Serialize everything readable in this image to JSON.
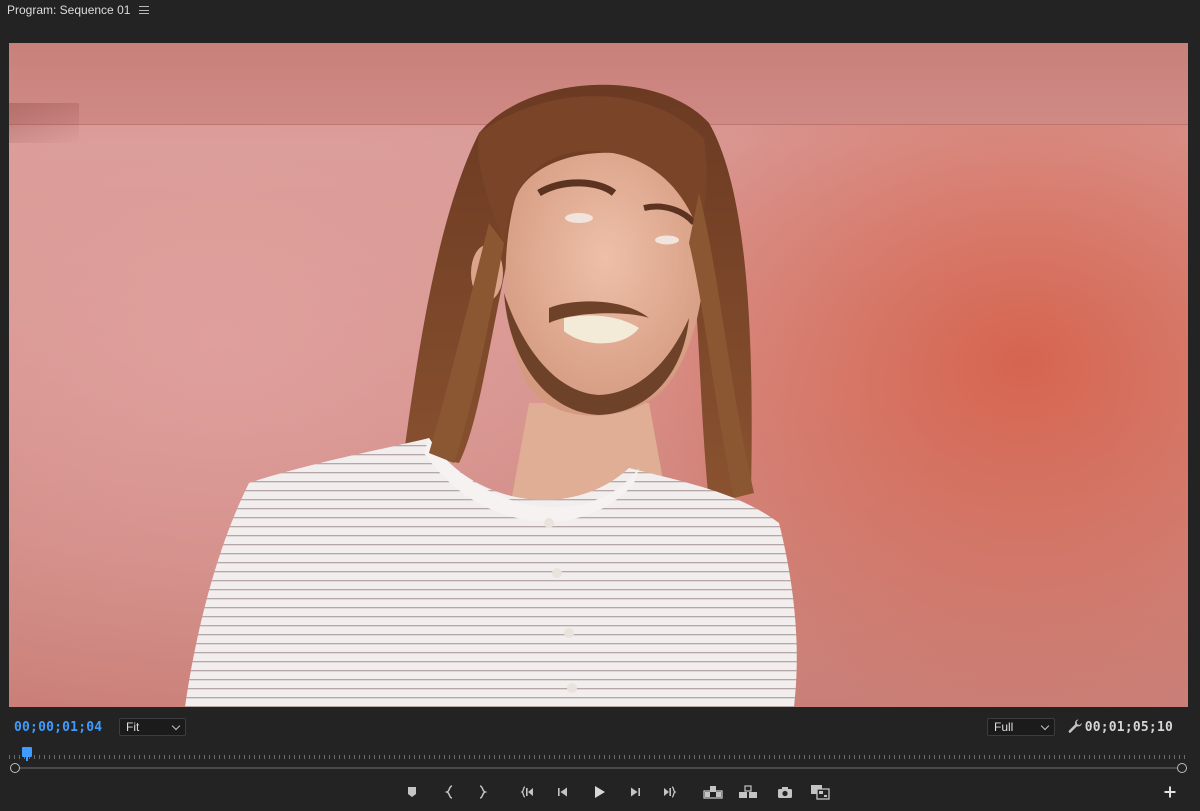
{
  "header": {
    "title": "Program: Sequence 01"
  },
  "controls": {
    "current_timecode": "00;00;01;04",
    "duration_timecode": "00;01;05;10",
    "zoom_select": "Fit",
    "resolution_select": "Full",
    "playhead_position": 0.012
  },
  "icons": {
    "panel_menu": "hamburger-icon",
    "settings": "wrench-icon",
    "transport": [
      "add-marker-icon",
      "mark-in-icon",
      "mark-out-icon",
      "go-to-in-icon",
      "step-back-icon",
      "play-icon",
      "step-forward-icon",
      "go-to-out-icon",
      "lift-icon",
      "extract-icon",
      "export-frame-icon",
      "comparison-view-icon"
    ],
    "add": "plus-icon"
  },
  "colors": {
    "accent": "#3e9cff",
    "panel_bg": "#232323"
  }
}
